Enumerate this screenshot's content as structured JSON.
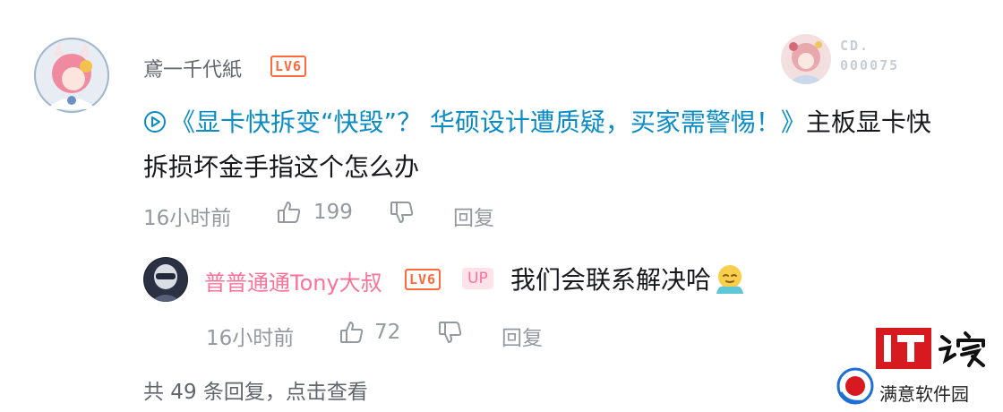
{
  "main_comment": {
    "username": "鳶一千代紙",
    "level_badge": "LV6",
    "fan_badge": {
      "line1": "CD.",
      "line2": "000075"
    },
    "video_link_text": "《显卡快拆变“快毁”？ 华硕设计遭质疑，买家需警惕！》",
    "content_text": "主板显卡快拆损坏金手指这个怎么办",
    "time": "16小时前",
    "like_count": "199",
    "reply_label": "回复"
  },
  "reply": {
    "username": "普普通通Tony大叔",
    "level_badge": "LV6",
    "up_badge": "UP",
    "content_text": "我们会联系解决哈",
    "time": "16小时前",
    "like_count": "72",
    "reply_label": "回复"
  },
  "more_replies_text": "共 49 条回复，点击查看",
  "watermark": {
    "site_text": "满意软件园",
    "logo_text": "IT之家"
  },
  "colors": {
    "link": "#0b8cc5",
    "up_name": "#fb7299",
    "level": "#ff6a3d",
    "meta": "#9499a0"
  },
  "icons": [
    "play-icon",
    "thumb-up-icon",
    "thumb-down-icon",
    "emoji-sticker",
    "it-home-logo",
    "site-logo-icon"
  ]
}
